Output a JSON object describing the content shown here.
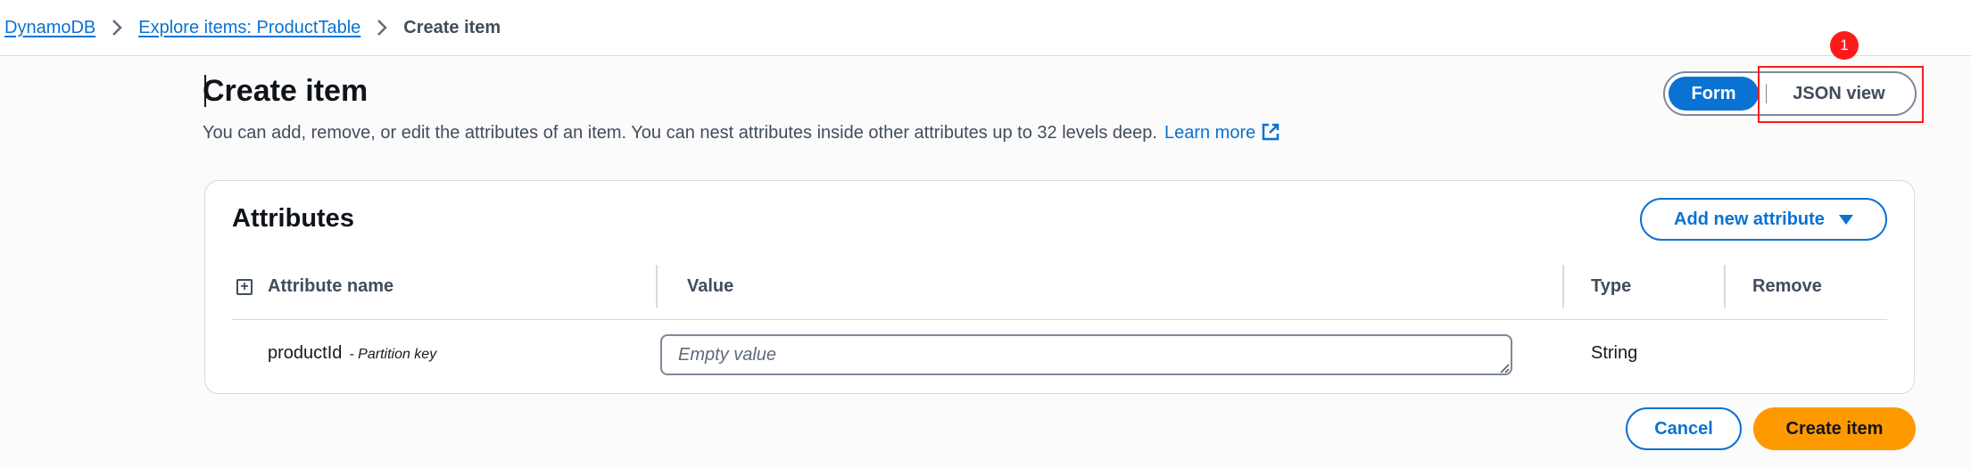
{
  "breadcrumb": {
    "items": [
      {
        "label": "DynamoDB"
      },
      {
        "label": "Explore items: ProductTable"
      },
      {
        "label": "Create item"
      }
    ]
  },
  "header": {
    "title": "Create item",
    "description": "You can add, remove, or edit the attributes of an item. You can nest attributes inside other attributes up to 32 levels deep.",
    "learn_more": "Learn more"
  },
  "view_toggle": {
    "form_label": "Form",
    "json_label": "JSON view",
    "selected": "Form"
  },
  "annotation": {
    "badge": "1"
  },
  "attributes": {
    "title": "Attributes",
    "add_button": "Add new attribute",
    "columns": {
      "name": "Attribute name",
      "value": "Value",
      "type": "Type",
      "remove": "Remove"
    },
    "rows": [
      {
        "name": "productId",
        "key_label": "- Partition key",
        "value": "",
        "placeholder": "Empty value",
        "type": "String"
      }
    ]
  },
  "footer": {
    "cancel": "Cancel",
    "create": "Create item"
  },
  "colors": {
    "link": "#0972d3",
    "primary": "#ff9900",
    "highlight": "#ff1a1a"
  }
}
